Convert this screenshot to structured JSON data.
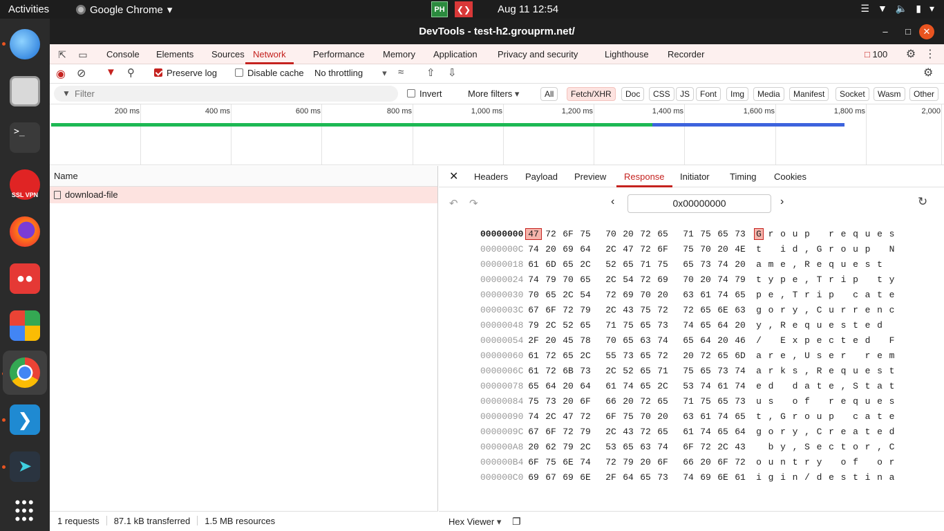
{
  "topbar": {
    "activities": "Activities",
    "app_name": "Google Chrome",
    "clock": "Aug 11  12:54",
    "tray_ph": "PH"
  },
  "window": {
    "title": "DevTools - test-h2.grouprm.net/"
  },
  "devtools_tabs": [
    "Console",
    "Elements",
    "Sources",
    "Network",
    "Performance",
    "Memory",
    "Application",
    "Privacy and security",
    "Lighthouse",
    "Recorder"
  ],
  "active_tab": "Network",
  "issues_count": "100",
  "toolbar": {
    "preserve_log": "Preserve log",
    "disable_cache": "Disable cache",
    "throttling": "No throttling"
  },
  "filter": {
    "placeholder": "Filter",
    "invert": "Invert",
    "more_filters": "More filters",
    "types": [
      "All",
      "Fetch/XHR",
      "Doc",
      "CSS",
      "JS",
      "Font",
      "Img",
      "Media",
      "Manifest",
      "Socket",
      "Wasm",
      "Other"
    ],
    "active_type": "Fetch/XHR"
  },
  "timeline": {
    "ticks": [
      "200 ms",
      "400 ms",
      "600 ms",
      "800 ms",
      "1,000 ms",
      "1,200 ms",
      "1,400 ms",
      "1,600 ms",
      "1,800 ms",
      "2,000"
    ],
    "colors": {
      "waiting": "#1db954",
      "download": "#3d63dd"
    }
  },
  "requests": {
    "column_name": "Name",
    "items": [
      {
        "name": "download-file"
      }
    ],
    "summary": {
      "requests": "1 requests",
      "transferred": "87.1 kB transferred",
      "resources": "1.5 MB resources"
    }
  },
  "detail": {
    "tabs": [
      "Headers",
      "Payload",
      "Preview",
      "Response",
      "Initiator",
      "Timing",
      "Cookies"
    ],
    "active_tab": "Response",
    "address": "0x00000000",
    "footer_view": "Hex Viewer"
  },
  "hex_rows": [
    {
      "addr": "00000000",
      "bytes": [
        "47",
        "72",
        "6F",
        "75",
        "70",
        "20",
        "72",
        "65",
        "71",
        "75",
        "65",
        "73"
      ],
      "ascii": [
        "G",
        "r",
        "o",
        "u",
        "p",
        " ",
        "r",
        "e",
        "q",
        "u",
        "e",
        "s"
      ]
    },
    {
      "addr": "0000000C",
      "bytes": [
        "74",
        "20",
        "69",
        "64",
        "2C",
        "47",
        "72",
        "6F",
        "75",
        "70",
        "20",
        "4E"
      ],
      "ascii": [
        "t",
        " ",
        "i",
        "d",
        ",",
        "G",
        "r",
        "o",
        "u",
        "p",
        " ",
        "N"
      ]
    },
    {
      "addr": "00000018",
      "bytes": [
        "61",
        "6D",
        "65",
        "2C",
        "52",
        "65",
        "71",
        "75",
        "65",
        "73",
        "74",
        "20"
      ],
      "ascii": [
        "a",
        "m",
        "e",
        ",",
        "R",
        "e",
        "q",
        "u",
        "e",
        "s",
        "t",
        " "
      ]
    },
    {
      "addr": "00000024",
      "bytes": [
        "74",
        "79",
        "70",
        "65",
        "2C",
        "54",
        "72",
        "69",
        "70",
        "20",
        "74",
        "79"
      ],
      "ascii": [
        "t",
        "y",
        "p",
        "e",
        ",",
        "T",
        "r",
        "i",
        "p",
        " ",
        "t",
        "y"
      ]
    },
    {
      "addr": "00000030",
      "bytes": [
        "70",
        "65",
        "2C",
        "54",
        "72",
        "69",
        "70",
        "20",
        "63",
        "61",
        "74",
        "65"
      ],
      "ascii": [
        "p",
        "e",
        ",",
        "T",
        "r",
        "i",
        "p",
        " ",
        "c",
        "a",
        "t",
        "e"
      ]
    },
    {
      "addr": "0000003C",
      "bytes": [
        "67",
        "6F",
        "72",
        "79",
        "2C",
        "43",
        "75",
        "72",
        "72",
        "65",
        "6E",
        "63"
      ],
      "ascii": [
        "g",
        "o",
        "r",
        "y",
        ",",
        "C",
        "u",
        "r",
        "r",
        "e",
        "n",
        "c"
      ]
    },
    {
      "addr": "00000048",
      "bytes": [
        "79",
        "2C",
        "52",
        "65",
        "71",
        "75",
        "65",
        "73",
        "74",
        "65",
        "64",
        "20"
      ],
      "ascii": [
        "y",
        ",",
        "R",
        "e",
        "q",
        "u",
        "e",
        "s",
        "t",
        "e",
        "d",
        " "
      ]
    },
    {
      "addr": "00000054",
      "bytes": [
        "2F",
        "20",
        "45",
        "78",
        "70",
        "65",
        "63",
        "74",
        "65",
        "64",
        "20",
        "46"
      ],
      "ascii": [
        "/",
        " ",
        "E",
        "x",
        "p",
        "e",
        "c",
        "t",
        "e",
        "d",
        " ",
        "F"
      ]
    },
    {
      "addr": "00000060",
      "bytes": [
        "61",
        "72",
        "65",
        "2C",
        "55",
        "73",
        "65",
        "72",
        "20",
        "72",
        "65",
        "6D"
      ],
      "ascii": [
        "a",
        "r",
        "e",
        ",",
        "U",
        "s",
        "e",
        "r",
        " ",
        "r",
        "e",
        "m"
      ]
    },
    {
      "addr": "0000006C",
      "bytes": [
        "61",
        "72",
        "6B",
        "73",
        "2C",
        "52",
        "65",
        "71",
        "75",
        "65",
        "73",
        "74"
      ],
      "ascii": [
        "a",
        "r",
        "k",
        "s",
        ",",
        "R",
        "e",
        "q",
        "u",
        "e",
        "s",
        "t"
      ]
    },
    {
      "addr": "00000078",
      "bytes": [
        "65",
        "64",
        "20",
        "64",
        "61",
        "74",
        "65",
        "2C",
        "53",
        "74",
        "61",
        "74"
      ],
      "ascii": [
        "e",
        "d",
        " ",
        "d",
        "a",
        "t",
        "e",
        ",",
        "S",
        "t",
        "a",
        "t"
      ]
    },
    {
      "addr": "00000084",
      "bytes": [
        "75",
        "73",
        "20",
        "6F",
        "66",
        "20",
        "72",
        "65",
        "71",
        "75",
        "65",
        "73"
      ],
      "ascii": [
        "u",
        "s",
        " ",
        "o",
        "f",
        " ",
        "r",
        "e",
        "q",
        "u",
        "e",
        "s"
      ]
    },
    {
      "addr": "00000090",
      "bytes": [
        "74",
        "2C",
        "47",
        "72",
        "6F",
        "75",
        "70",
        "20",
        "63",
        "61",
        "74",
        "65"
      ],
      "ascii": [
        "t",
        ",",
        "G",
        "r",
        "o",
        "u",
        "p",
        " ",
        "c",
        "a",
        "t",
        "e"
      ]
    },
    {
      "addr": "0000009C",
      "bytes": [
        "67",
        "6F",
        "72",
        "79",
        "2C",
        "43",
        "72",
        "65",
        "61",
        "74",
        "65",
        "64"
      ],
      "ascii": [
        "g",
        "o",
        "r",
        "y",
        ",",
        "C",
        "r",
        "e",
        "a",
        "t",
        "e",
        "d"
      ]
    },
    {
      "addr": "000000A8",
      "bytes": [
        "20",
        "62",
        "79",
        "2C",
        "53",
        "65",
        "63",
        "74",
        "6F",
        "72",
        "2C",
        "43"
      ],
      "ascii": [
        " ",
        "b",
        "y",
        ",",
        "S",
        "e",
        "c",
        "t",
        "o",
        "r",
        ",",
        "C"
      ]
    },
    {
      "addr": "000000B4",
      "bytes": [
        "6F",
        "75",
        "6E",
        "74",
        "72",
        "79",
        "20",
        "6F",
        "66",
        "20",
        "6F",
        "72"
      ],
      "ascii": [
        "o",
        "u",
        "n",
        "t",
        "r",
        "y",
        " ",
        "o",
        "f",
        " ",
        "o",
        "r"
      ]
    },
    {
      "addr": "000000C0",
      "bytes": [
        "69",
        "67",
        "69",
        "6E",
        "2F",
        "64",
        "65",
        "73",
        "74",
        "69",
        "6E",
        "61"
      ],
      "ascii": [
        "i",
        "g",
        "i",
        "n",
        "/",
        "d",
        "e",
        "s",
        "t",
        "i",
        "n",
        "a"
      ]
    }
  ]
}
